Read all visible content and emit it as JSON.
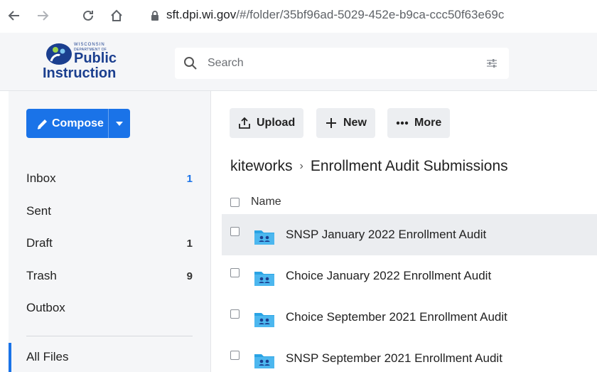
{
  "browser": {
    "url_host": "sft.dpi.wi.gov",
    "url_path": "/#/folder/35bf96ad-5029-452e-b9ca-ccc50f63e69c"
  },
  "logo": {
    "state": "WISCONSIN",
    "department": "DEPARTMENT OF",
    "line1": "Public",
    "line2": "Instruction"
  },
  "search": {
    "placeholder": "Search",
    "value": ""
  },
  "compose": {
    "label": "Compose"
  },
  "sidebar": {
    "items": [
      {
        "label": "Inbox",
        "count": "1"
      },
      {
        "label": "Sent",
        "count": ""
      },
      {
        "label": "Draft",
        "count": "1"
      },
      {
        "label": "Trash",
        "count": "9"
      },
      {
        "label": "Outbox",
        "count": ""
      }
    ],
    "all_files": "All Files"
  },
  "toolbar": {
    "upload": "Upload",
    "new": "New",
    "more": "More"
  },
  "breadcrumb": {
    "root": "kiteworks",
    "current": "Enrollment Audit Submissions"
  },
  "table": {
    "column_name": "Name",
    "rows": [
      {
        "name": "SNSP January 2022 Enrollment Audit"
      },
      {
        "name": "Choice January 2022 Enrollment Audit"
      },
      {
        "name": "Choice September 2021 Enrollment Audit"
      },
      {
        "name": "SNSP September 2021 Enrollment Audit"
      }
    ]
  },
  "colors": {
    "accent": "#1a73e8",
    "folder": "#29a3e4",
    "sidebar_bg": "#f5f6f8",
    "row_highlight": "#ebedf0"
  }
}
